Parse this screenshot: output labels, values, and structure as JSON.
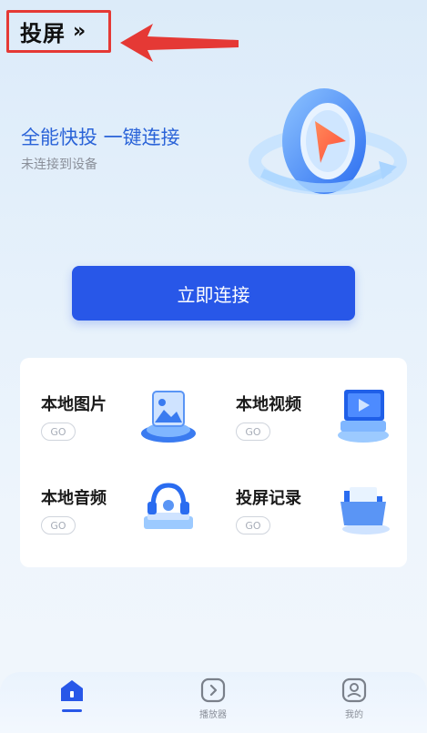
{
  "header": {
    "title": "投屏",
    "chevron": "››"
  },
  "hero": {
    "title": "全能快投 一键连接",
    "subtitle": "未连接到设备"
  },
  "connect_button": {
    "label": "立即连接"
  },
  "features": [
    {
      "label": "本地图片",
      "go": "GO",
      "icon": "image-icon"
    },
    {
      "label": "本地视频",
      "go": "GO",
      "icon": "video-icon"
    },
    {
      "label": "本地音频",
      "go": "GO",
      "icon": "headphones-icon"
    },
    {
      "label": "投屏记录",
      "go": "GO",
      "icon": "folder-icon"
    }
  ],
  "tabbar": {
    "items": [
      {
        "label": "",
        "icon": "home-icon",
        "active": true
      },
      {
        "label": "播放器",
        "icon": "player-icon",
        "active": false
      },
      {
        "label": "我的",
        "icon": "profile-icon",
        "active": false
      }
    ]
  },
  "colors": {
    "accent": "#2857e8",
    "annotation": "#e53935"
  }
}
